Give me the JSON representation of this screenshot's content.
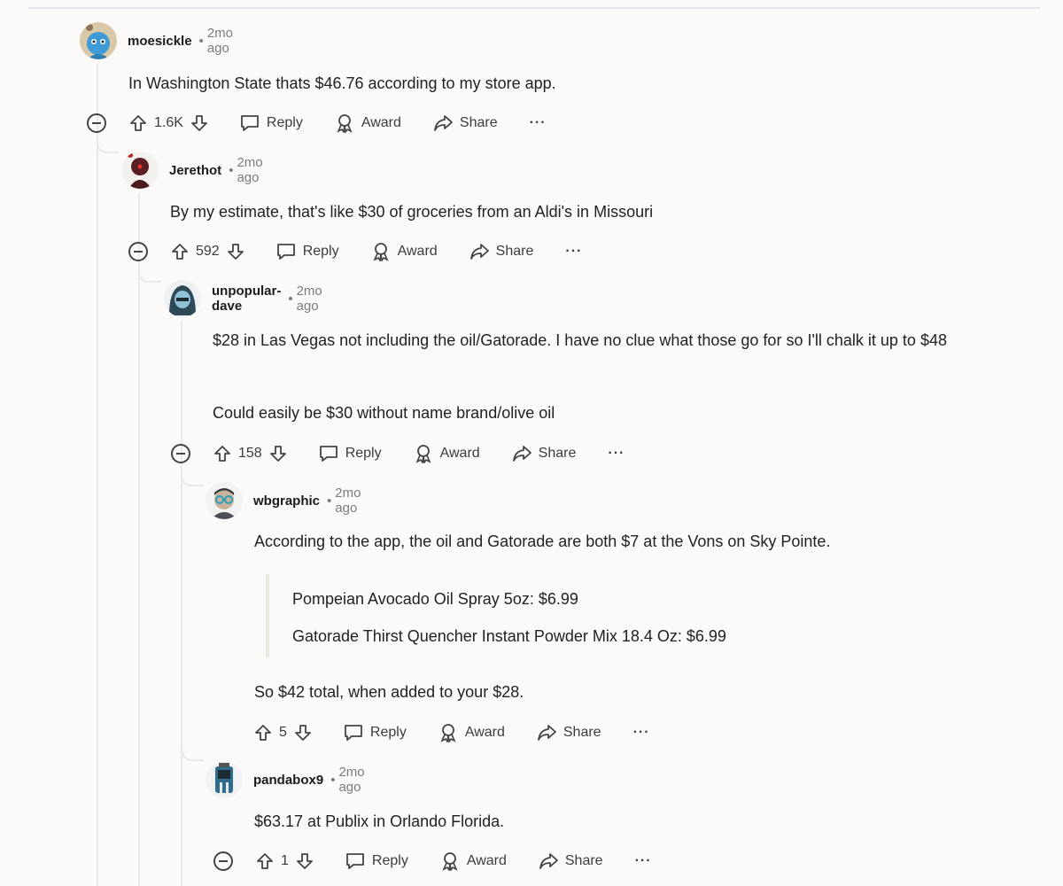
{
  "labels": {
    "reply": "Reply",
    "award": "Award",
    "share": "Share",
    "more": "···",
    "dot": "•"
  },
  "colors": {
    "background": "#fbfaf8",
    "rail": "#ece9e4",
    "text": "#1c1c1c",
    "meta": "#7c7c7c"
  },
  "comments": [
    {
      "user": "moesickle",
      "time": "2mo ago",
      "avatar_icon": "blue-avatar-icon",
      "body": [
        "In Washington State thats $46.76 according to my store app."
      ],
      "votes": "1.6K"
    },
    {
      "user": "Jerethot",
      "time": "2mo ago",
      "avatar_icon": "dark-red-avatar-icon",
      "body": [
        "By my estimate, that's like $30 of groceries from an Aldi's in Missouri"
      ],
      "votes": "592"
    },
    {
      "user": "unpopular-dave",
      "time": "2mo ago",
      "avatar_icon": "hooded-avatar-icon",
      "body": [
        "$28 in Las Vegas not including the oil/Gatorade. I have no clue what those go for so I'll chalk it up to $48",
        "Could easily be $30 without name brand/olive oil"
      ],
      "votes": "158"
    },
    {
      "user": "wbgraphic",
      "time": "2mo ago",
      "avatar_icon": "glasses-avatar-icon",
      "body": [
        "According to the app, the oil and Gatorade are both $7 at the Vons on Sky Pointe."
      ],
      "quote": [
        "Pompeian Avocado Oil Spray 5oz: $6.99",
        "Gatorade Thirst Quencher Instant Powder Mix 18.4 Oz: $6.99"
      ],
      "after_quote": "So $42 total, when added to your $28.",
      "votes": "5"
    },
    {
      "user": "pandabox9",
      "time": "2mo ago",
      "avatar_icon": "robot-avatar-icon",
      "body": [
        "$63.17 at Publix in Orlando Florida."
      ],
      "votes": "1"
    }
  ]
}
